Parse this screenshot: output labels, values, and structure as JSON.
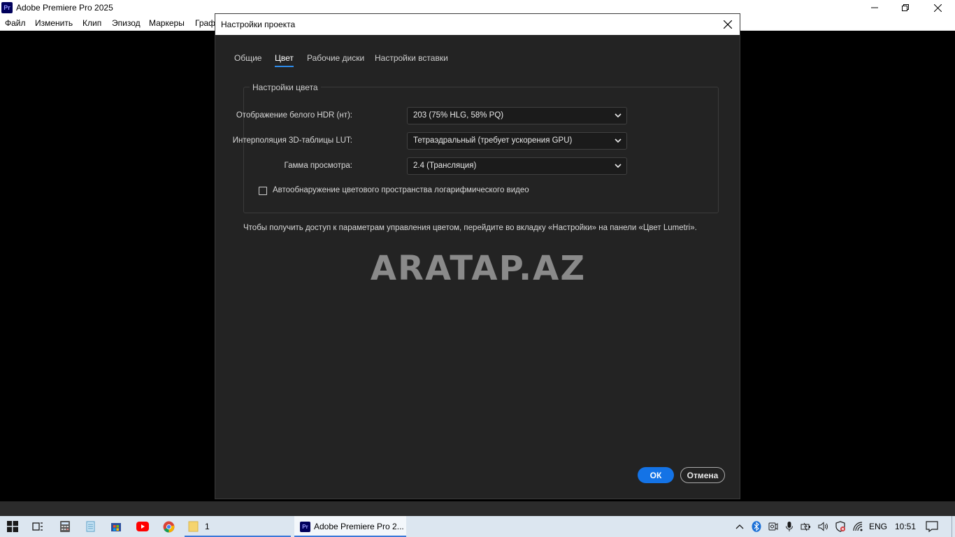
{
  "app": {
    "title": "Adobe Premiere Pro 2025",
    "icon_text": "Pr",
    "menu": [
      "Файл",
      "Изменить",
      "Клип",
      "Эпизод",
      "Маркеры",
      "Граф"
    ]
  },
  "dialog": {
    "title": "Настройки проекта",
    "tabs": [
      "Общие",
      "Цвет",
      "Рабочие диски",
      "Настройки вставки"
    ],
    "active_tab": "Цвет",
    "group_title": "Настройки цвета",
    "rows": [
      {
        "label": "Отображение белого HDR (нт):",
        "value": "203 (75% HLG, 58% PQ)"
      },
      {
        "label": "Интерполяция 3D-таблицы LUT:",
        "value": "Тетраэдральный (требует ускорения GPU)"
      },
      {
        "label": "Гамма просмотра:",
        "value": "2.4 (Трансляция)"
      }
    ],
    "checkbox": {
      "label": "Автообнаружение цветового пространства логарифмического видео",
      "checked": false
    },
    "info": "Чтобы получить доступ к параметрам управления цветом, перейдите во вкладку «Настройки» на панели «Цвет Lumetri».",
    "watermark": "ARATAP.AZ",
    "ok_label": "ОК",
    "cancel_label": "Отмена"
  },
  "taskbar": {
    "folder_label": "1",
    "active_app_label": "Adobe Premiere Pro 2...",
    "language": "ENG",
    "time": "10:51"
  },
  "colors": {
    "accent": "#1473e6",
    "dialog_bg": "#232323",
    "tab_underline": "#2d8ceb"
  }
}
